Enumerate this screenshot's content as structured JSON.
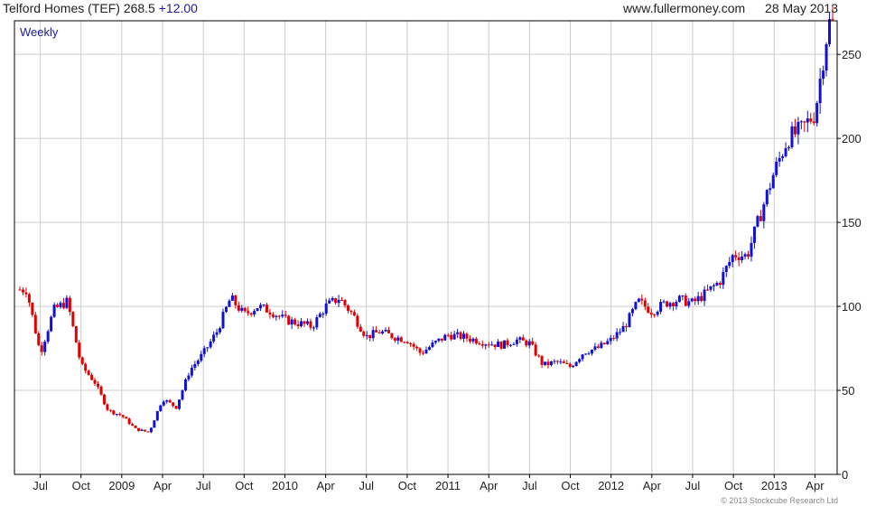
{
  "header": {
    "title": "Telford Homes (TEF)",
    "last": "268.5",
    "change": "+12.00",
    "site": "www.fullermoney.com",
    "date": "28 May 2013"
  },
  "period_label": "Weekly",
  "copyright": "© 2013 Stockcube Research Ltd",
  "colors": {
    "up": "#1010d8",
    "down": "#e00000",
    "grid": "#cccccc",
    "frame": "#000000"
  },
  "chart_data": {
    "type": "candlestick",
    "title": "Telford Homes (TEF)",
    "ylim": [
      0,
      270
    ],
    "y_ticks": [
      0,
      50,
      100,
      150,
      200,
      250
    ],
    "x_ticks": [
      "Jul",
      "Oct",
      "2009",
      "Apr",
      "Jul",
      "Oct",
      "2010",
      "Apr",
      "Jul",
      "Oct",
      "2011",
      "Apr",
      "Jul",
      "Oct",
      "2012",
      "Apr",
      "Jul",
      "Oct",
      "2013",
      "Apr"
    ],
    "x_tick_months": [
      "2008-07",
      "2008-10",
      "2009-01",
      "2009-04",
      "2009-07",
      "2009-10",
      "2010-01",
      "2010-04",
      "2010-07",
      "2010-10",
      "2011-01",
      "2011-04",
      "2011-07",
      "2011-10",
      "2012-01",
      "2012-04",
      "2012-07",
      "2012-10",
      "2013-01",
      "2013-04"
    ],
    "grid": true,
    "close_series": {
      "name": "Close",
      "points": [
        [
          "2008-06",
          110
        ],
        [
          "2008-07",
          72
        ],
        [
          "2008-08",
          98
        ],
        [
          "2008-09",
          103
        ],
        [
          "2008-10",
          65
        ],
        [
          "2008-11",
          55
        ],
        [
          "2008-12",
          38
        ],
        [
          "2009-01",
          35
        ],
        [
          "2009-02",
          27
        ],
        [
          "2009-03",
          25
        ],
        [
          "2009-04",
          45
        ],
        [
          "2009-05",
          40
        ],
        [
          "2009-06",
          62
        ],
        [
          "2009-07",
          72
        ],
        [
          "2009-08",
          85
        ],
        [
          "2009-09",
          105
        ],
        [
          "2009-10",
          95
        ],
        [
          "2009-11",
          100
        ],
        [
          "2009-12",
          97
        ],
        [
          "2010-01",
          92
        ],
        [
          "2010-02",
          90
        ],
        [
          "2010-03",
          88
        ],
        [
          "2010-04",
          100
        ],
        [
          "2010-05",
          105
        ],
        [
          "2010-06",
          95
        ],
        [
          "2010-07",
          82
        ],
        [
          "2010-08",
          85
        ],
        [
          "2010-09",
          82
        ],
        [
          "2010-10",
          80
        ],
        [
          "2010-11",
          72
        ],
        [
          "2010-12",
          78
        ],
        [
          "2011-01",
          83
        ],
        [
          "2011-02",
          82
        ],
        [
          "2011-03",
          80
        ],
        [
          "2011-04",
          78
        ],
        [
          "2011-05",
          77
        ],
        [
          "2011-06",
          80
        ],
        [
          "2011-07",
          78
        ],
        [
          "2011-08",
          65
        ],
        [
          "2011-09",
          67
        ],
        [
          "2011-10",
          64
        ],
        [
          "2011-11",
          73
        ],
        [
          "2011-12",
          75
        ],
        [
          "2012-01",
          80
        ],
        [
          "2012-02",
          88
        ],
        [
          "2012-03",
          103
        ],
        [
          "2012-04",
          97
        ],
        [
          "2012-05",
          102
        ],
        [
          "2012-06",
          104
        ],
        [
          "2012-07",
          102
        ],
        [
          "2012-08",
          108
        ],
        [
          "2012-09",
          115
        ],
        [
          "2012-10",
          131
        ],
        [
          "2012-11",
          130
        ],
        [
          "2012-12",
          155
        ],
        [
          "2013-01",
          180
        ],
        [
          "2013-02",
          200
        ],
        [
          "2013-03",
          205
        ],
        [
          "2013-04",
          215
        ],
        [
          "2013-05",
          268.5
        ]
      ]
    }
  }
}
